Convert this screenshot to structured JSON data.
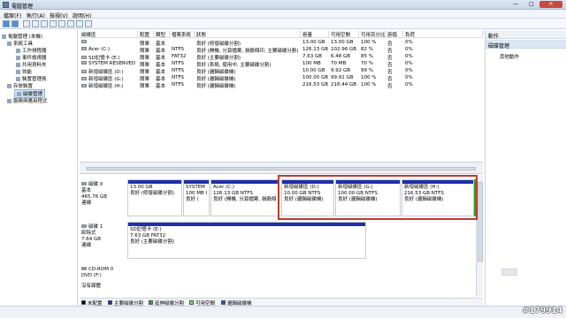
{
  "window": {
    "title": "電腦管理",
    "min": "—",
    "max": "□",
    "close": "✕"
  },
  "menu": [
    "檔案(F)",
    "執行(A)",
    "檢視(V)",
    "說明(H)"
  ],
  "tree": [
    {
      "label": "電腦管理 (本機)",
      "level": 0
    },
    {
      "label": "系統工具",
      "level": 1
    },
    {
      "label": "工作排程器",
      "level": 2
    },
    {
      "label": "事件檢視器",
      "level": 2
    },
    {
      "label": "共用資料夾",
      "level": 2
    },
    {
      "label": "效能",
      "level": 2
    },
    {
      "label": "裝置管理員",
      "level": 2
    },
    {
      "label": "存放裝置",
      "level": 1
    },
    {
      "label": "磁碟管理",
      "level": 2
    },
    {
      "label": "服務與應用程式",
      "level": 1
    }
  ],
  "volumes": {
    "headers": [
      "磁碟區",
      "配置",
      "類型",
      "檔案系統",
      "狀態",
      "容量",
      "可用空間",
      "可用百分比",
      "容錯",
      "負荷"
    ],
    "rows": [
      [
        "",
        "簡單",
        "基本",
        "",
        "良好 (修復磁碟分割)",
        "13.00 GB",
        "13.00 GB",
        "100 %",
        "否",
        "0%"
      ],
      [
        "Acer (C:)",
        "簡單",
        "基本",
        "NTFS",
        "良好 (開機, 分頁檔案, 損毀傾印, 主要磁碟分割)",
        "126.13 GB",
        "102.96 GB",
        "82 %",
        "否",
        "0%"
      ],
      [
        "SD記憶卡 (E:)",
        "簡單",
        "基本",
        "FAT32",
        "良好 (主要磁碟分割)",
        "7.63 GB",
        "6.48 GB",
        "85 %",
        "否",
        "0%"
      ],
      [
        "SYSTEM RESERVED",
        "簡單",
        "基本",
        "NTFS",
        "良好 (系統, 使用中, 主要磁碟分割)",
        "100 MB",
        "70 MB",
        "70 %",
        "否",
        "0%"
      ],
      [
        "新增磁碟區 (D:)",
        "簡單",
        "基本",
        "NTFS",
        "良好 (邏輯磁碟機)",
        "10.00 GB",
        "9.92 GB",
        "99 %",
        "否",
        "0%"
      ],
      [
        "新增磁碟區 (G:)",
        "簡單",
        "基本",
        "NTFS",
        "良好 (邏輯磁碟機)",
        "100.00 GB",
        "99.91 GB",
        "100 %",
        "否",
        "0%"
      ],
      [
        "新增磁碟區 (H:)",
        "簡單",
        "基本",
        "NTFS",
        "良好 (邏輯磁碟機)",
        "216.53 GB",
        "216.44 GB",
        "100 %",
        "否",
        "0%"
      ]
    ]
  },
  "disks": [
    {
      "name": "磁碟 0",
      "type": "基本",
      "size": "465.76 GB",
      "status": "連線",
      "partitions": [
        {
          "title": "",
          "size": "13.00 GB",
          "status": "良好 (修復磁碟分割)",
          "color": "#1f2fa8"
        },
        {
          "title": "SYSTEM",
          "size": "100 MB I",
          "status": "良好 (",
          "color": "#1f2fa8"
        },
        {
          "title": "Acer (C:)",
          "size": "126.13 GB NTFS",
          "status": "良好 (開機, 分頁檔案, 損毀傾",
          "color": "#1f2fa8"
        },
        {
          "title": "新增磁碟區 (D:)",
          "size": "10.00 GB NTFS",
          "status": "良好 (邏輯磁碟機)",
          "color": "#1f2fa8"
        },
        {
          "title": "新增磁碟區 (G:)",
          "size": "100.00 GB NTFS",
          "status": "良好 (邏輯磁碟機)",
          "color": "#1f2fa8"
        },
        {
          "title": "新增磁碟區 (H:)",
          "size": "216.53 GB NTFS",
          "status": "良好 (邏輯磁碟機)",
          "color": "#1f2fa8"
        }
      ]
    },
    {
      "name": "磁碟 1",
      "type": "卸除式",
      "size": "7.64 GB",
      "status": "連線",
      "partitions": [
        {
          "title": "SD記憶卡 (E:)",
          "size": "7.63 GB FAT32",
          "status": "良好 (主要磁碟分割)",
          "color": "#1f2fa8"
        }
      ]
    },
    {
      "name": "CD-ROM 0",
      "type": "DVD (F:)",
      "size": "",
      "status": "沒有媒體",
      "partitions": []
    }
  ],
  "legend": [
    {
      "label": "未配置",
      "color": "#000000"
    },
    {
      "label": "主要磁碟分割",
      "color": "#1f2fa8"
    },
    {
      "label": "延伸磁碟分割",
      "color": "#2ea043"
    },
    {
      "label": "可用空間",
      "color": "#7cd67c"
    },
    {
      "label": "邏輯磁碟機",
      "color": "#2b4fd6"
    }
  ],
  "actions": {
    "header": "動作",
    "section": "磁碟管理",
    "more": "其他動作"
  },
  "watermark": "#179914"
}
